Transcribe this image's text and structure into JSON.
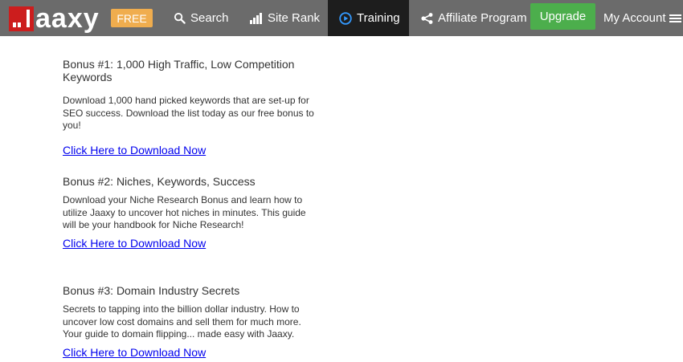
{
  "nav": {
    "logo_text": "aaxy",
    "free_badge": "FREE",
    "search": "Search",
    "site_rank": "Site Rank",
    "training": "Training",
    "affiliate": "Affiliate Program",
    "upgrade": "Upgrade",
    "my_account": "My Account",
    "brand_color": "#cc1d1d",
    "badge_color": "#f0ad4e",
    "upgrade_color": "#4cae4c",
    "active_color": "#1d1d1d",
    "training_icon_color": "#3399ff"
  },
  "bonuses": [
    {
      "title": "Bonus #1: 1,000 High Traffic, Low Competition Keywords",
      "description": "Download 1,000 hand picked keywords that are set-up for SEO success. Download the list today as our free bonus to you!",
      "link": "Click Here to Download Now"
    },
    {
      "title": "Bonus #2: Niches, Keywords, Success",
      "description": "Download your Niche Research Bonus and learn how to utilize Jaaxy to uncover hot niches in minutes. This guide will be your handbook for Niche Research!",
      "link": "Click Here to Download Now"
    },
    {
      "title": "Bonus #3: Domain Industry Secrets",
      "description": "Secrets to tapping into the billion dollar industry. How to uncover low cost domains and sell them for much more. Your guide to domain flipping... made easy with Jaaxy.",
      "link": "Click Here to Download Now"
    }
  ]
}
